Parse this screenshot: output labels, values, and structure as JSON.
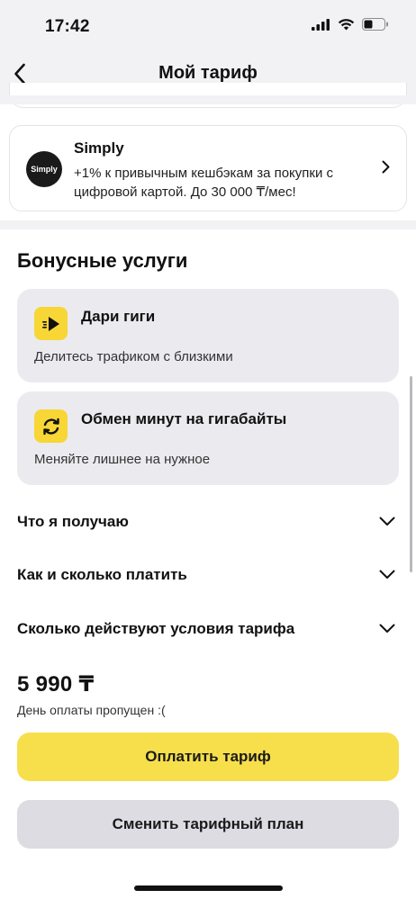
{
  "status_bar": {
    "time": "17:42",
    "icons": [
      "signal-icon",
      "wifi-icon",
      "battery-icon"
    ]
  },
  "nav": {
    "title": "Мой тариф",
    "back_icon": "chevron-left-icon"
  },
  "simply": {
    "logo_text": "Simply",
    "title": "Simply",
    "description": "+1% к привычным кешбэкам за покупки с цифровой картой. До 30 000 ₸/мес!"
  },
  "bonus": {
    "heading": "Бонусные услуги",
    "items": [
      {
        "title": "Дари гиги",
        "description": "Делитесь трафиком с близкими",
        "icon": "send-icon"
      },
      {
        "title": "Обмен минут на гигабайты",
        "description": "Меняйте лишнее на нужное",
        "icon": "exchange-icon"
      }
    ]
  },
  "accordion": [
    {
      "label": "Что я получаю"
    },
    {
      "label": "Как и сколько платить"
    },
    {
      "label": "Сколько действуют условия тарифа"
    }
  ],
  "payment": {
    "price": "5 990 ₸",
    "status": "День оплаты пропущен :("
  },
  "buttons": {
    "pay": "Оплатить тариф",
    "change": "Сменить тарифный план"
  },
  "colors": {
    "accent_yellow": "#f7df4c",
    "icon_yellow": "#f7d636",
    "card_gray": "#ebebef",
    "secondary_button": "#dcdce2"
  }
}
